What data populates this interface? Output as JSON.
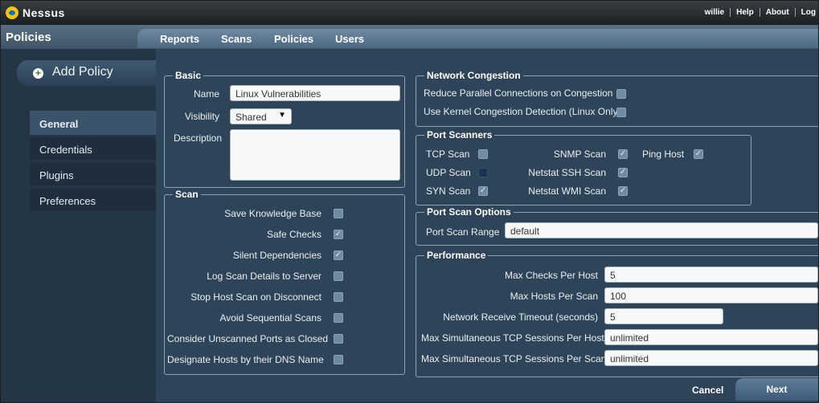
{
  "app": {
    "name": "Nessus",
    "user": "willie",
    "links": [
      "Help",
      "About",
      "Log"
    ]
  },
  "page": {
    "title": "Policies"
  },
  "nav": {
    "tabs": [
      "Reports",
      "Scans",
      "Policies",
      "Users"
    ]
  },
  "sidebar": {
    "add_policy": "Add Policy",
    "items": [
      "General",
      "Credentials",
      "Plugins",
      "Preferences"
    ],
    "active": "General"
  },
  "basic": {
    "legend": "Basic",
    "name_label": "Name",
    "name_value": "Linux Vulnerabilities",
    "visibility_label": "Visibility",
    "visibility_value": "Shared",
    "description_label": "Description",
    "description_value": ""
  },
  "scan": {
    "legend": "Scan",
    "options": [
      {
        "label": "Save Knowledge Base",
        "checked": false
      },
      {
        "label": "Safe Checks",
        "checked": true
      },
      {
        "label": "Silent Dependencies",
        "checked": true
      },
      {
        "label": "Log Scan Details to Server",
        "checked": false
      },
      {
        "label": "Stop Host Scan on Disconnect",
        "checked": false
      },
      {
        "label": "Avoid Sequential Scans",
        "checked": false
      },
      {
        "label": "Consider Unscanned Ports as Closed",
        "checked": false
      },
      {
        "label": "Designate Hosts by their DNS Name",
        "checked": false
      }
    ]
  },
  "network": {
    "legend": "Network Congestion",
    "options": [
      {
        "label": "Reduce Parallel Connections on Congestion",
        "checked": false
      },
      {
        "label": "Use Kernel Congestion Detection (Linux Only)",
        "checked": false
      }
    ]
  },
  "port_scanners": {
    "legend": "Port Scanners",
    "options": [
      {
        "label": "TCP Scan",
        "checked": false
      },
      {
        "label": "UDP Scan",
        "checked": false
      },
      {
        "label": "SYN Scan",
        "checked": true
      },
      {
        "label": "SNMP Scan",
        "checked": true
      },
      {
        "label": "Netstat SSH Scan",
        "checked": true
      },
      {
        "label": "Netstat WMI Scan",
        "checked": true
      },
      {
        "label": "Ping Host",
        "checked": true
      }
    ]
  },
  "port_scan_options": {
    "legend": "Port Scan Options",
    "range_label": "Port Scan Range",
    "range_value": "default"
  },
  "performance": {
    "legend": "Performance",
    "fields": [
      {
        "label": "Max Checks Per Host",
        "value": "5"
      },
      {
        "label": "Max Hosts Per Scan",
        "value": "100"
      },
      {
        "label": "Network Receive Timeout (seconds)",
        "value": "5"
      },
      {
        "label": "Max Simultaneous TCP Sessions Per Host",
        "value": "unlimited"
      },
      {
        "label": "Max Simultaneous TCP Sessions Per Scan",
        "value": "unlimited"
      }
    ]
  },
  "actions": {
    "cancel": "Cancel",
    "next": "Next"
  },
  "colors": {
    "background": "#2e4458",
    "sidebar": "#243545",
    "accent": "#f1c419"
  }
}
